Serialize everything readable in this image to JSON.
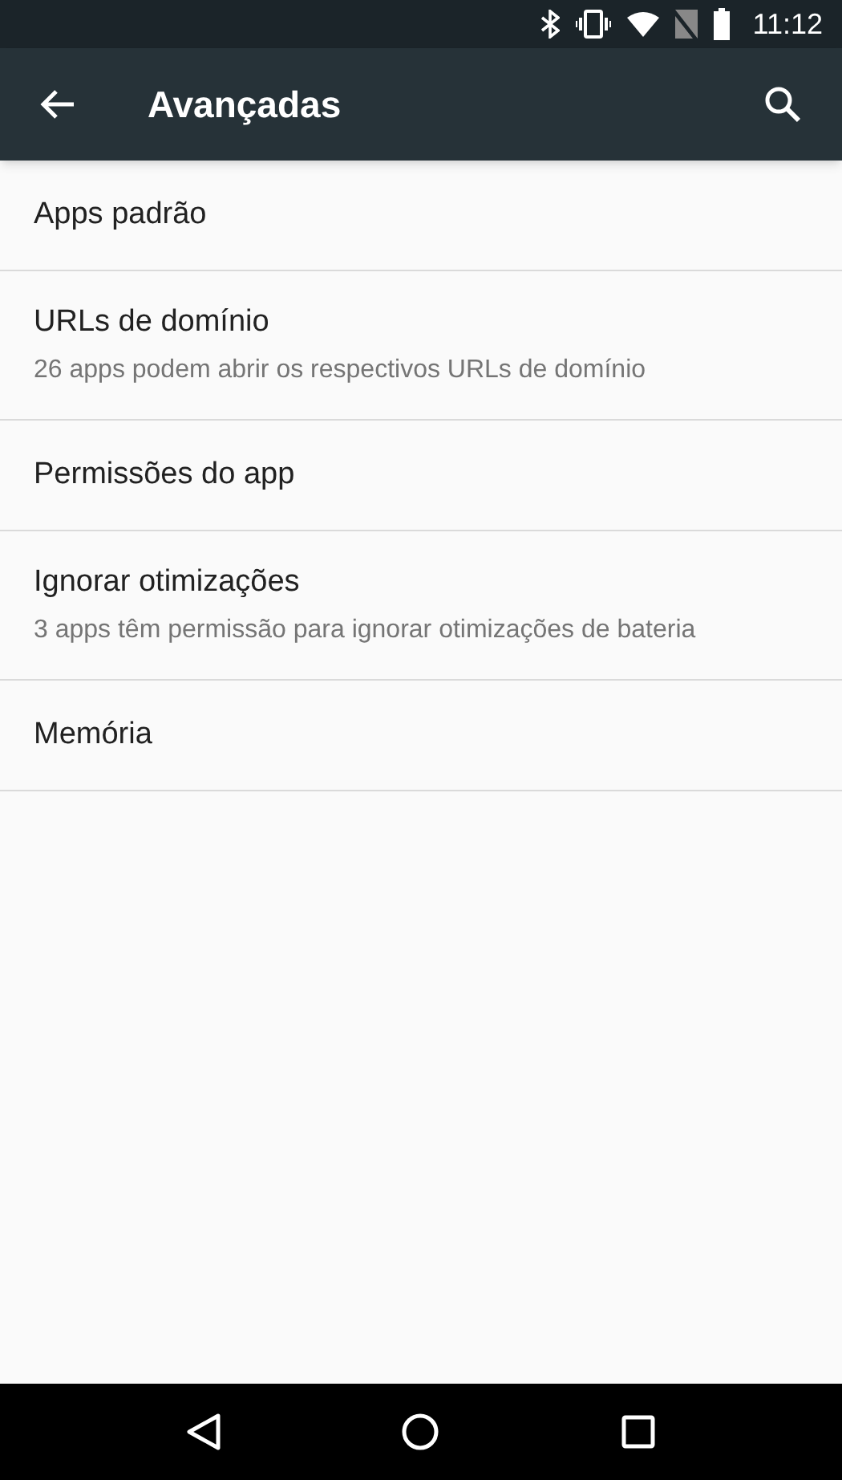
{
  "status_bar": {
    "time": "11:12"
  },
  "toolbar": {
    "title": "Avançadas"
  },
  "items": [
    {
      "title": "Apps padrão"
    },
    {
      "title": "URLs de domínio",
      "subtitle": "26 apps podem abrir os respectivos URLs de domínio"
    },
    {
      "title": "Permissões do app"
    },
    {
      "title": "Ignorar otimizações",
      "subtitle": "3 apps têm permissão para ignorar otimizações de bateria"
    },
    {
      "title": "Memória"
    }
  ]
}
